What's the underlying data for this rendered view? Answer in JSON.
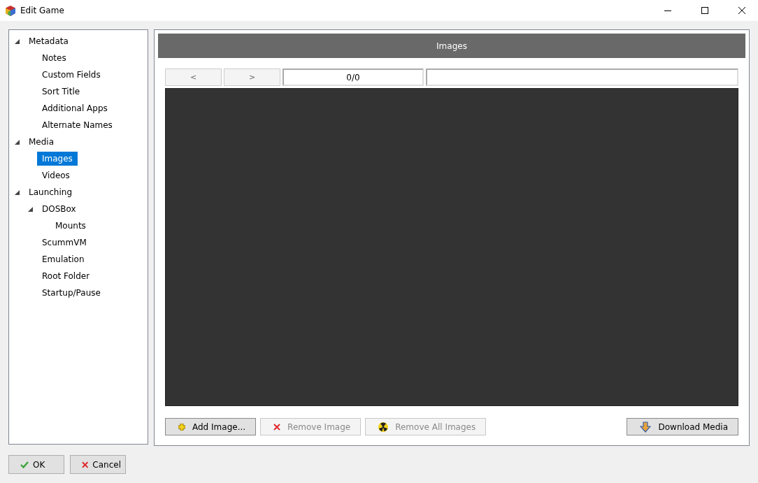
{
  "window": {
    "title": "Edit Game"
  },
  "tree": [
    {
      "label": "Metadata",
      "expanded": true,
      "selected": false,
      "children": [
        {
          "label": "Notes",
          "selected": false
        },
        {
          "label": "Custom Fields",
          "selected": false
        },
        {
          "label": "Sort Title",
          "selected": false
        },
        {
          "label": "Additional Apps",
          "selected": false
        },
        {
          "label": "Alternate Names",
          "selected": false
        }
      ]
    },
    {
      "label": "Media",
      "expanded": true,
      "selected": false,
      "children": [
        {
          "label": "Images",
          "selected": true
        },
        {
          "label": "Videos",
          "selected": false
        }
      ]
    },
    {
      "label": "Launching",
      "expanded": true,
      "selected": false,
      "children": [
        {
          "label": "DOSBox",
          "expanded": true,
          "selected": false,
          "children": [
            {
              "label": "Mounts",
              "selected": false
            }
          ]
        },
        {
          "label": "ScummVM",
          "selected": false
        },
        {
          "label": "Emulation",
          "selected": false
        },
        {
          "label": "Root Folder",
          "selected": false
        },
        {
          "label": "Startup/Pause",
          "selected": false
        }
      ]
    }
  ],
  "panel": {
    "title": "Images",
    "prev": "<",
    "next": ">",
    "counter": "0/0"
  },
  "actions": [
    {
      "kind": "add",
      "label": "Add Image...",
      "disabled": false
    },
    {
      "kind": "remove",
      "label": "Remove Image",
      "disabled": true
    },
    {
      "kind": "remove-all",
      "label": "Remove All Images",
      "disabled": true
    },
    {
      "kind": "download",
      "label": "Download Media",
      "disabled": false
    }
  ],
  "footer": [
    {
      "kind": "ok",
      "label": "OK"
    },
    {
      "kind": "cancel",
      "label": "Cancel"
    }
  ]
}
